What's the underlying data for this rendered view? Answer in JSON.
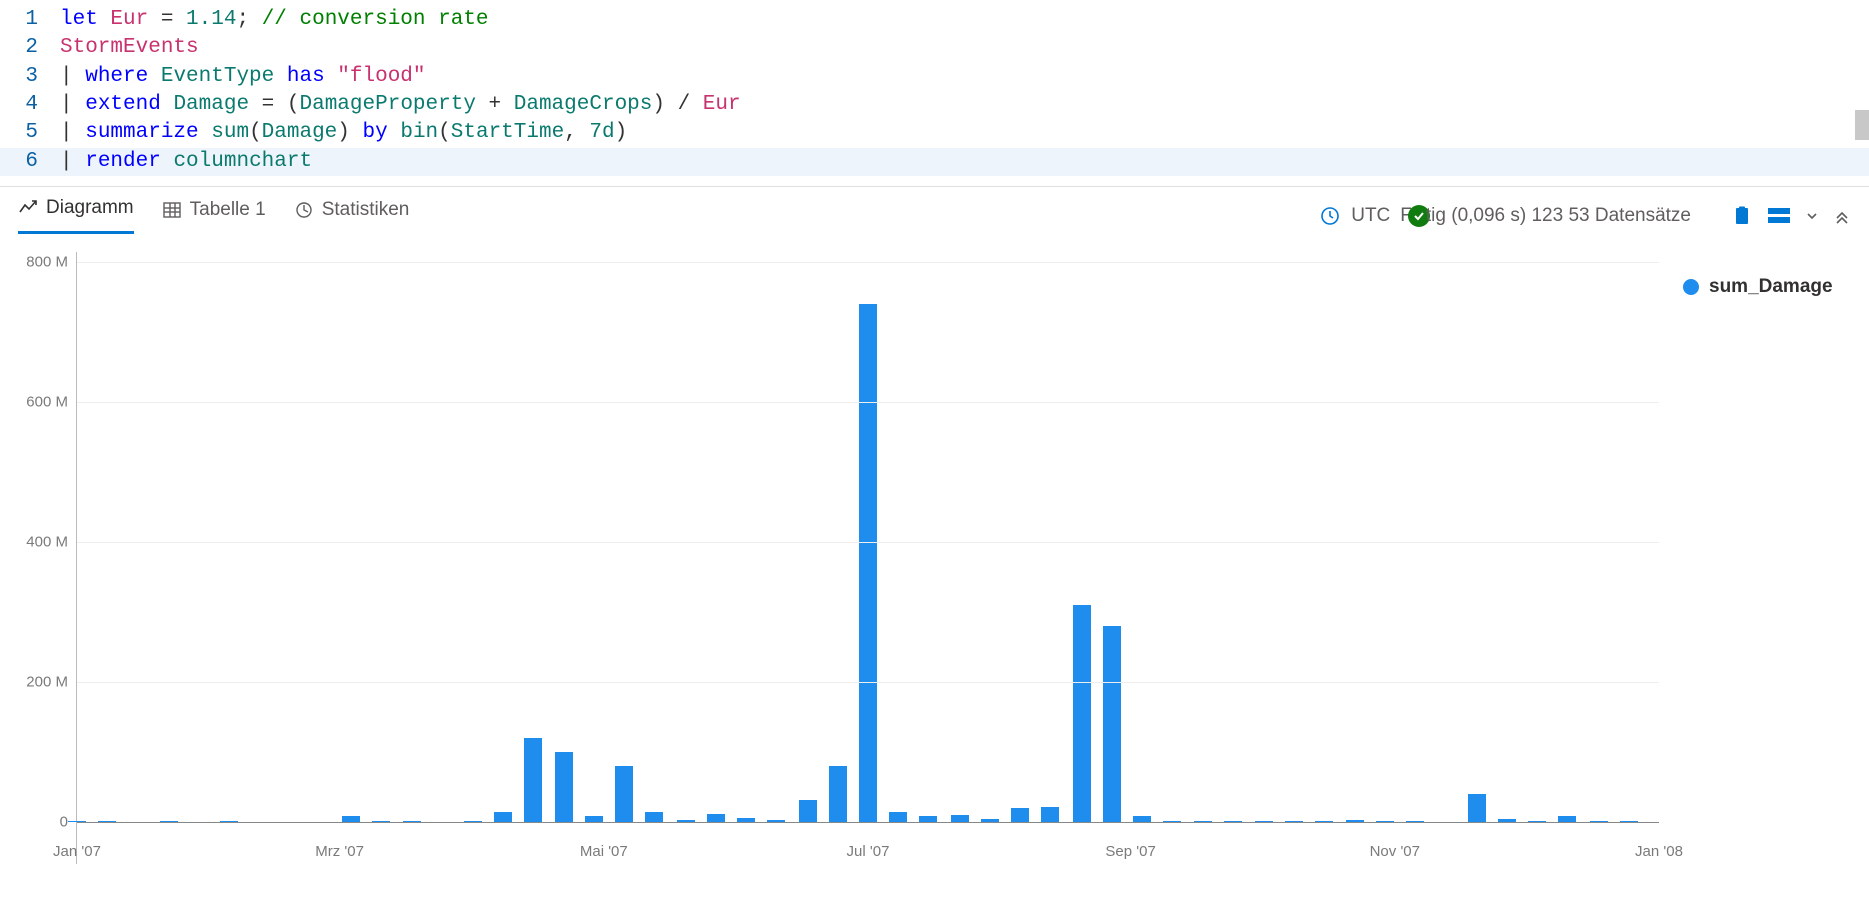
{
  "editor": {
    "lines": [
      {
        "n": "1",
        "tokens": [
          {
            "t": "let",
            "c": "tok-keyword"
          },
          {
            "t": " ",
            "c": ""
          },
          {
            "t": "Eur",
            "c": "tok-ident"
          },
          {
            "t": " = ",
            "c": "tok-op"
          },
          {
            "t": "1.14",
            "c": "tok-number"
          },
          {
            "t": "; ",
            "c": "tok-op"
          },
          {
            "t": "// conversion rate",
            "c": "tok-comment"
          }
        ]
      },
      {
        "n": "2",
        "tokens": [
          {
            "t": "StormEvents",
            "c": "tok-ident"
          }
        ]
      },
      {
        "n": "3",
        "tokens": [
          {
            "t": "| ",
            "c": "tok-pipe"
          },
          {
            "t": "where",
            "c": "tok-keyword"
          },
          {
            "t": " ",
            "c": ""
          },
          {
            "t": "EventType",
            "c": "tok-field"
          },
          {
            "t": " ",
            "c": ""
          },
          {
            "t": "has",
            "c": "tok-keyword"
          },
          {
            "t": " ",
            "c": ""
          },
          {
            "t": "\"flood\"",
            "c": "tok-string"
          }
        ]
      },
      {
        "n": "4",
        "tokens": [
          {
            "t": "| ",
            "c": "tok-pipe"
          },
          {
            "t": "extend",
            "c": "tok-keyword"
          },
          {
            "t": " ",
            "c": ""
          },
          {
            "t": "Damage",
            "c": "tok-field"
          },
          {
            "t": " = (",
            "c": "tok-op"
          },
          {
            "t": "DamageProperty",
            "c": "tok-field"
          },
          {
            "t": " + ",
            "c": "tok-op"
          },
          {
            "t": "DamageCrops",
            "c": "tok-field"
          },
          {
            "t": ") / ",
            "c": "tok-op"
          },
          {
            "t": "Eur",
            "c": "tok-ident"
          }
        ]
      },
      {
        "n": "5",
        "tokens": [
          {
            "t": "| ",
            "c": "tok-pipe"
          },
          {
            "t": "summarize",
            "c": "tok-keyword"
          },
          {
            "t": " ",
            "c": ""
          },
          {
            "t": "sum",
            "c": "tok-func"
          },
          {
            "t": "(",
            "c": "tok-op"
          },
          {
            "t": "Damage",
            "c": "tok-field"
          },
          {
            "t": ") ",
            "c": "tok-op"
          },
          {
            "t": "by",
            "c": "tok-keyword"
          },
          {
            "t": " ",
            "c": ""
          },
          {
            "t": "bin",
            "c": "tok-func"
          },
          {
            "t": "(",
            "c": "tok-op"
          },
          {
            "t": "StartTime",
            "c": "tok-field"
          },
          {
            "t": ", ",
            "c": "tok-op"
          },
          {
            "t": "7d",
            "c": "tok-number"
          },
          {
            "t": ")",
            "c": "tok-op"
          }
        ]
      },
      {
        "n": "6",
        "active": true,
        "tokens": [
          {
            "t": "| ",
            "c": "tok-pipe"
          },
          {
            "t": "render",
            "c": "tok-keyword"
          },
          {
            "t": " ",
            "c": ""
          },
          {
            "t": "columnchart",
            "c": "tok-field"
          }
        ]
      }
    ]
  },
  "tabs": {
    "diagram": "Diagramm",
    "table": "Tabelle 1",
    "stats": "Statistiken"
  },
  "status": {
    "utc": "UTC",
    "fertig_pre": "F",
    "fertig_post": "tig (0,096 s) 123 53 Datensätze"
  },
  "legend": {
    "series": "sum_Damage"
  },
  "chart_data": {
    "type": "bar",
    "title": "",
    "xlabel": "",
    "ylabel": "",
    "ylim": [
      0,
      800000000
    ],
    "y_ticks": [
      "0",
      "200 M",
      "400 M",
      "600 M",
      "800 M"
    ],
    "x_ticks": [
      {
        "label": "Jan '07",
        "pos": 0.0
      },
      {
        "label": "Mrz '07",
        "pos": 0.166
      },
      {
        "label": "Mai '07",
        "pos": 0.333
      },
      {
        "label": "Jul '07",
        "pos": 0.5
      },
      {
        "label": "Sep '07",
        "pos": 0.666
      },
      {
        "label": "Nov '07",
        "pos": 0.833
      },
      {
        "label": "Jan '08",
        "pos": 1.0
      }
    ],
    "series": [
      {
        "name": "sum_Damage",
        "color": "#1f8ded",
        "points": [
          {
            "x": 0.0,
            "y": 2000000
          },
          {
            "x": 0.019,
            "y": 2000000
          },
          {
            "x": 0.058,
            "y": 2000000
          },
          {
            "x": 0.096,
            "y": 1000000
          },
          {
            "x": 0.173,
            "y": 8000000
          },
          {
            "x": 0.192,
            "y": 2000000
          },
          {
            "x": 0.212,
            "y": 1000000
          },
          {
            "x": 0.25,
            "y": 2000000
          },
          {
            "x": 0.269,
            "y": 15000000
          },
          {
            "x": 0.288,
            "y": 120000000
          },
          {
            "x": 0.308,
            "y": 100000000
          },
          {
            "x": 0.327,
            "y": 8000000
          },
          {
            "x": 0.346,
            "y": 80000000
          },
          {
            "x": 0.365,
            "y": 15000000
          },
          {
            "x": 0.385,
            "y": 3000000
          },
          {
            "x": 0.404,
            "y": 12000000
          },
          {
            "x": 0.423,
            "y": 6000000
          },
          {
            "x": 0.442,
            "y": 3000000
          },
          {
            "x": 0.462,
            "y": 32000000
          },
          {
            "x": 0.481,
            "y": 80000000
          },
          {
            "x": 0.5,
            "y": 740000000
          },
          {
            "x": 0.519,
            "y": 15000000
          },
          {
            "x": 0.538,
            "y": 8000000
          },
          {
            "x": 0.558,
            "y": 10000000
          },
          {
            "x": 0.577,
            "y": 5000000
          },
          {
            "x": 0.596,
            "y": 20000000
          },
          {
            "x": 0.615,
            "y": 22000000
          },
          {
            "x": 0.635,
            "y": 310000000
          },
          {
            "x": 0.654,
            "y": 280000000
          },
          {
            "x": 0.673,
            "y": 8000000
          },
          {
            "x": 0.692,
            "y": 2000000
          },
          {
            "x": 0.712,
            "y": 2000000
          },
          {
            "x": 0.731,
            "y": 1000000
          },
          {
            "x": 0.75,
            "y": 1000000
          },
          {
            "x": 0.769,
            "y": 2000000
          },
          {
            "x": 0.788,
            "y": 1000000
          },
          {
            "x": 0.808,
            "y": 3000000
          },
          {
            "x": 0.827,
            "y": 1000000
          },
          {
            "x": 0.846,
            "y": 2000000
          },
          {
            "x": 0.885,
            "y": 40000000
          },
          {
            "x": 0.904,
            "y": 4000000
          },
          {
            "x": 0.923,
            "y": 2000000
          },
          {
            "x": 0.942,
            "y": 8000000
          },
          {
            "x": 0.962,
            "y": 2000000
          },
          {
            "x": 0.981,
            "y": 1000000
          }
        ]
      }
    ]
  }
}
